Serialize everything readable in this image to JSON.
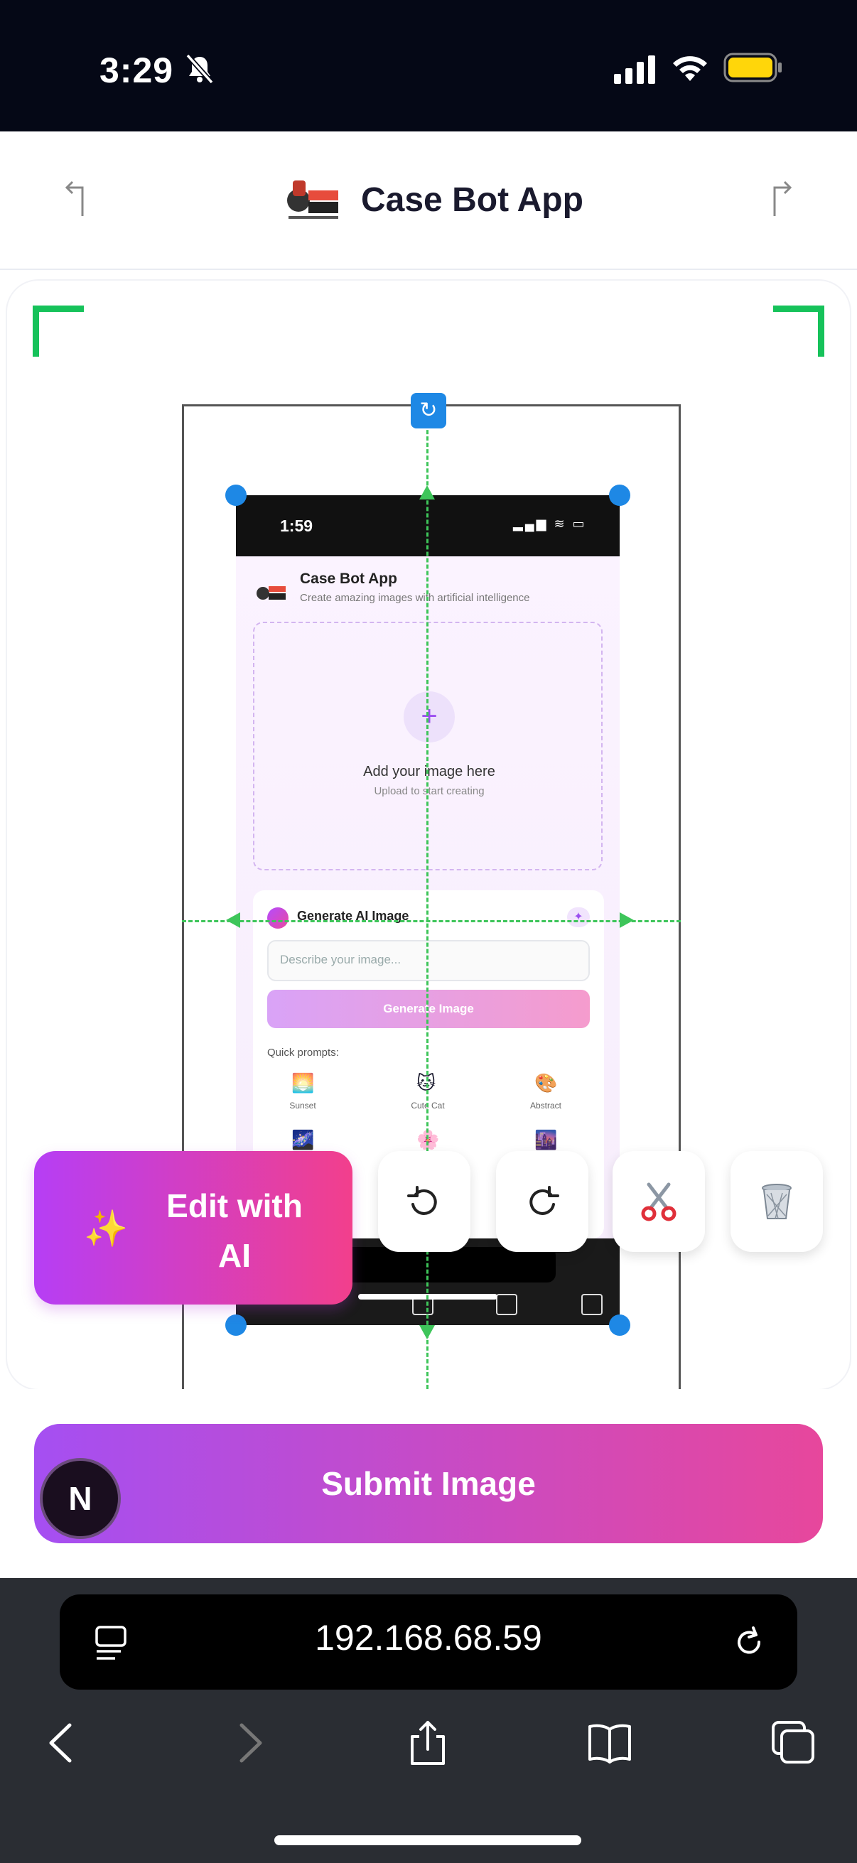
{
  "status_bar": {
    "time": "3:29"
  },
  "header": {
    "title": "Case Bot App"
  },
  "preview": {
    "time": "1:59",
    "app_title": "Case Bot App",
    "app_subtitle": "Create amazing images with artificial intelligence",
    "dropzone_title": "Add your image here",
    "dropzone_subtitle": "Upload to start creating",
    "generate_title": "Generate AI Image",
    "prompt_placeholder": "Describe your image...",
    "generate_button": "Generate Image",
    "quick_prompts_label": "Quick prompts:",
    "quick_prompts": [
      {
        "emoji": "🌅",
        "label": "Sunset"
      },
      {
        "emoji": "🐱",
        "label": "Cute Cat"
      },
      {
        "emoji": "🎨",
        "label": "Abstract"
      }
    ],
    "quick_prompts_row2": [
      "🌌",
      "🌸",
      "🌆"
    ]
  },
  "toolbar": {
    "edit_ai_label": "Edit with AI",
    "edit_ai_icon": "sparkles-icon",
    "rotate_left_icon": "rotate-left-icon",
    "rotate_right_icon": "rotate-right-icon",
    "cut_icon": "✂️",
    "delete_icon": "trash-icon"
  },
  "actions": {
    "submit_label": "Submit Image",
    "badge_letter": "N"
  },
  "browser": {
    "url": "192.168.68.59"
  },
  "colors": {
    "accent_purple": "#a54ff2",
    "accent_pink": "#e7479c",
    "crop_green": "#16c25a",
    "handle_blue": "#1e88e5"
  }
}
